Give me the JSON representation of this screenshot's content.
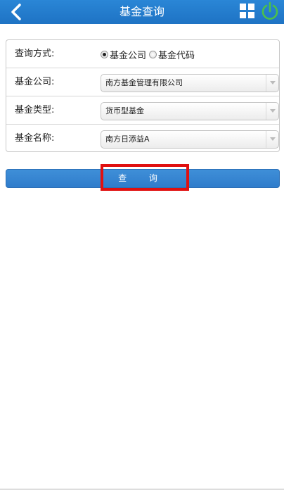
{
  "header": {
    "title": "基金查询",
    "back_icon": "chevron-left-icon",
    "grid_icon": "grid-icon",
    "power_icon": "power-icon",
    "power_color": "#4cc04a"
  },
  "form": {
    "query_method": {
      "label": "查询方式:",
      "options": [
        "基金公司",
        "基金代码"
      ],
      "selected": "基金公司"
    },
    "fund_company": {
      "label": "基金公司:",
      "value": "南方基金管理有限公司"
    },
    "fund_type": {
      "label": "基金类型:",
      "value": "货币型基金"
    },
    "fund_name": {
      "label": "基金名称:",
      "value": "南方日添益A"
    }
  },
  "query_button": {
    "label": "查 询"
  },
  "colors": {
    "accent": "#2a86d6",
    "highlight": "#e01010"
  }
}
